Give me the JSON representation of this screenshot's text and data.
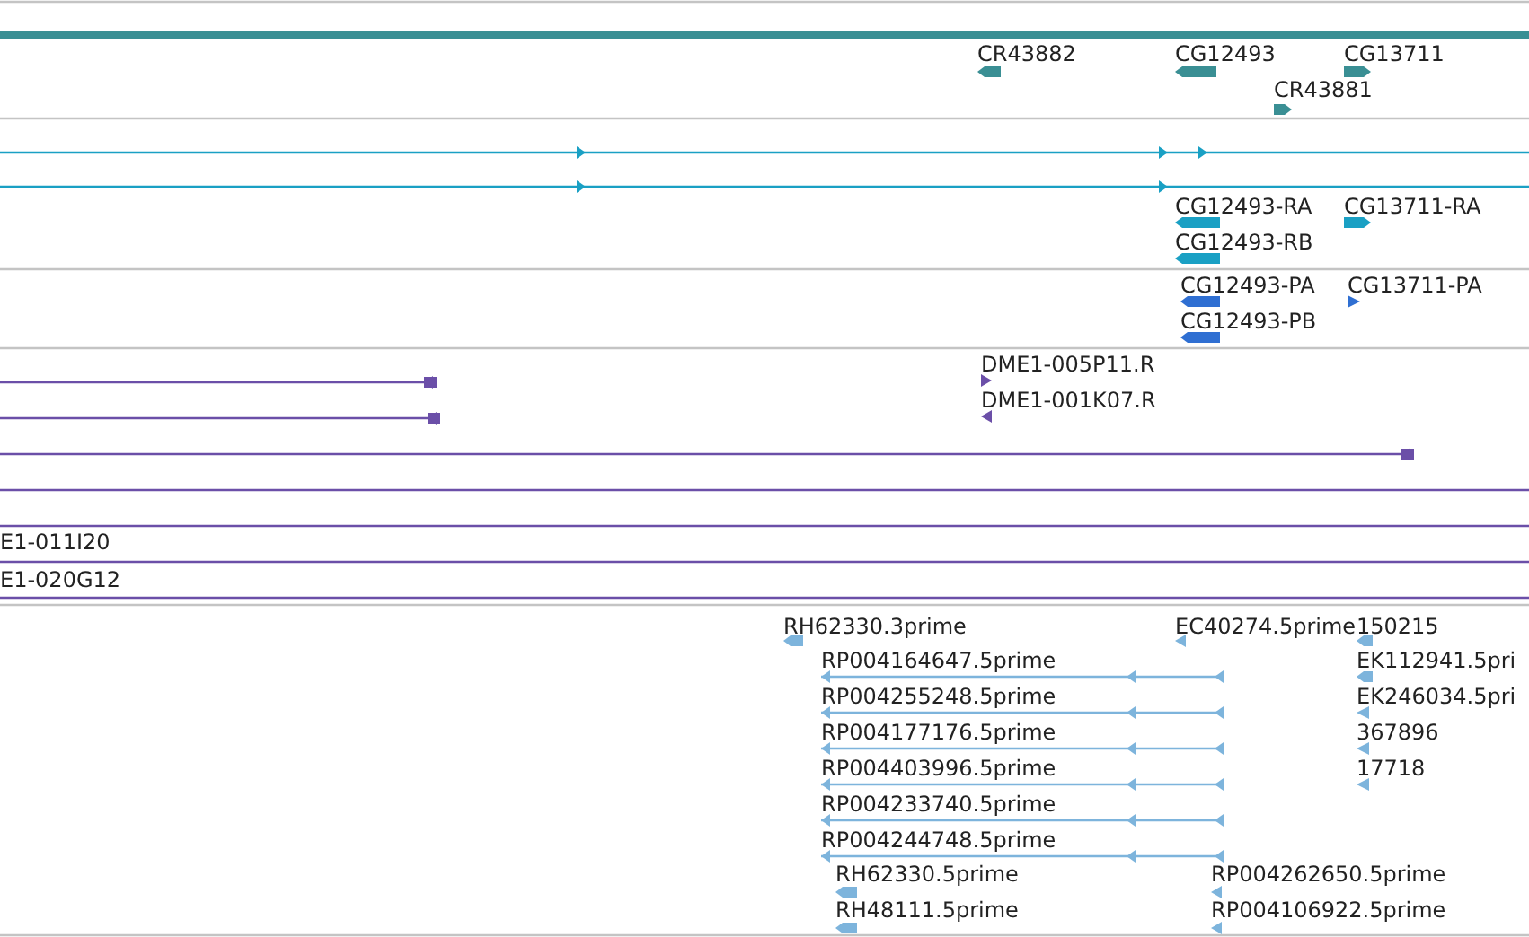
{
  "tracks": [
    {
      "color": "#3a8f94",
      "features": [
        {
          "kind": "bar"
        },
        {
          "kind": "block",
          "label": "CR43882",
          "reverse": true
        },
        {
          "kind": "block",
          "label": "CG12493",
          "reverse": true
        },
        {
          "kind": "block",
          "label": "CG13711",
          "reverse": false
        },
        {
          "kind": "block",
          "label": "CR43881",
          "reverse": false
        }
      ]
    },
    {
      "color": "#1aa0c4",
      "features": [
        {
          "kind": "spliced",
          "reverse": false
        },
        {
          "kind": "spliced",
          "reverse": false
        },
        {
          "kind": "block",
          "label": "CG12493-RA",
          "reverse": true
        },
        {
          "kind": "block",
          "label": "CG13711-RA",
          "reverse": false
        },
        {
          "kind": "block",
          "label": "CG12493-RB",
          "reverse": true
        }
      ]
    },
    {
      "color": "#2f6fd2",
      "features": [
        {
          "kind": "block",
          "label": "CG12493-PA",
          "reverse": true
        },
        {
          "kind": "arrowhead",
          "label": "CG13711-PA",
          "reverse": false
        },
        {
          "kind": "block",
          "label": "CG12493-PB",
          "reverse": true
        }
      ]
    },
    {
      "color": "#6b4fa8",
      "features": [
        {
          "kind": "capped",
          "reverse": false
        },
        {
          "kind": "capped",
          "reverse": false
        },
        {
          "kind": "arrowhead",
          "label": "DME1-005P11.R",
          "reverse": false
        },
        {
          "kind": "arrowhead",
          "label": "DME1-001K07.R",
          "reverse": true
        },
        {
          "kind": "capped",
          "reverse": false
        },
        {
          "kind": "span"
        },
        {
          "kind": "span"
        },
        {
          "kind": "span",
          "label": "E1-011I20"
        },
        {
          "kind": "span",
          "label": "E1-020G12"
        }
      ]
    },
    {
      "color": "#7db4dc",
      "features": [
        {
          "kind": "block",
          "label": "RH62330.3prime",
          "reverse": true
        },
        {
          "kind": "arrowhead",
          "label": "EC40274.5prime",
          "reverse": true
        },
        {
          "kind": "block",
          "label": "150215",
          "reverse": true
        },
        {
          "kind": "spliced",
          "label": "RP004164647.5prime",
          "reverse": true
        },
        {
          "kind": "block",
          "label": "EK112941.5pri",
          "reverse": true
        },
        {
          "kind": "spliced",
          "label": "RP004255248.5prime",
          "reverse": true
        },
        {
          "kind": "arrowhead",
          "label": "EK246034.5pri",
          "reverse": true
        },
        {
          "kind": "spliced",
          "label": "RP004177176.5prime",
          "reverse": true
        },
        {
          "kind": "arrowhead",
          "label": "367896",
          "reverse": true
        },
        {
          "kind": "spliced",
          "label": "RP004403996.5prime",
          "reverse": true
        },
        {
          "kind": "arrowhead",
          "label": "17718",
          "reverse": true
        },
        {
          "kind": "spliced",
          "label": "RP004233740.5prime",
          "reverse": true
        },
        {
          "kind": "spliced",
          "label": "RP004244748.5prime",
          "reverse": true
        },
        {
          "kind": "block",
          "label": "RH62330.5prime",
          "reverse": true
        },
        {
          "kind": "arrowhead",
          "label": "RP004262650.5prime",
          "reverse": true
        },
        {
          "kind": "block",
          "label": "RH48111.5prime",
          "reverse": true
        },
        {
          "kind": "arrowhead",
          "label": "RP004106922.5prime",
          "reverse": true
        }
      ]
    }
  ]
}
